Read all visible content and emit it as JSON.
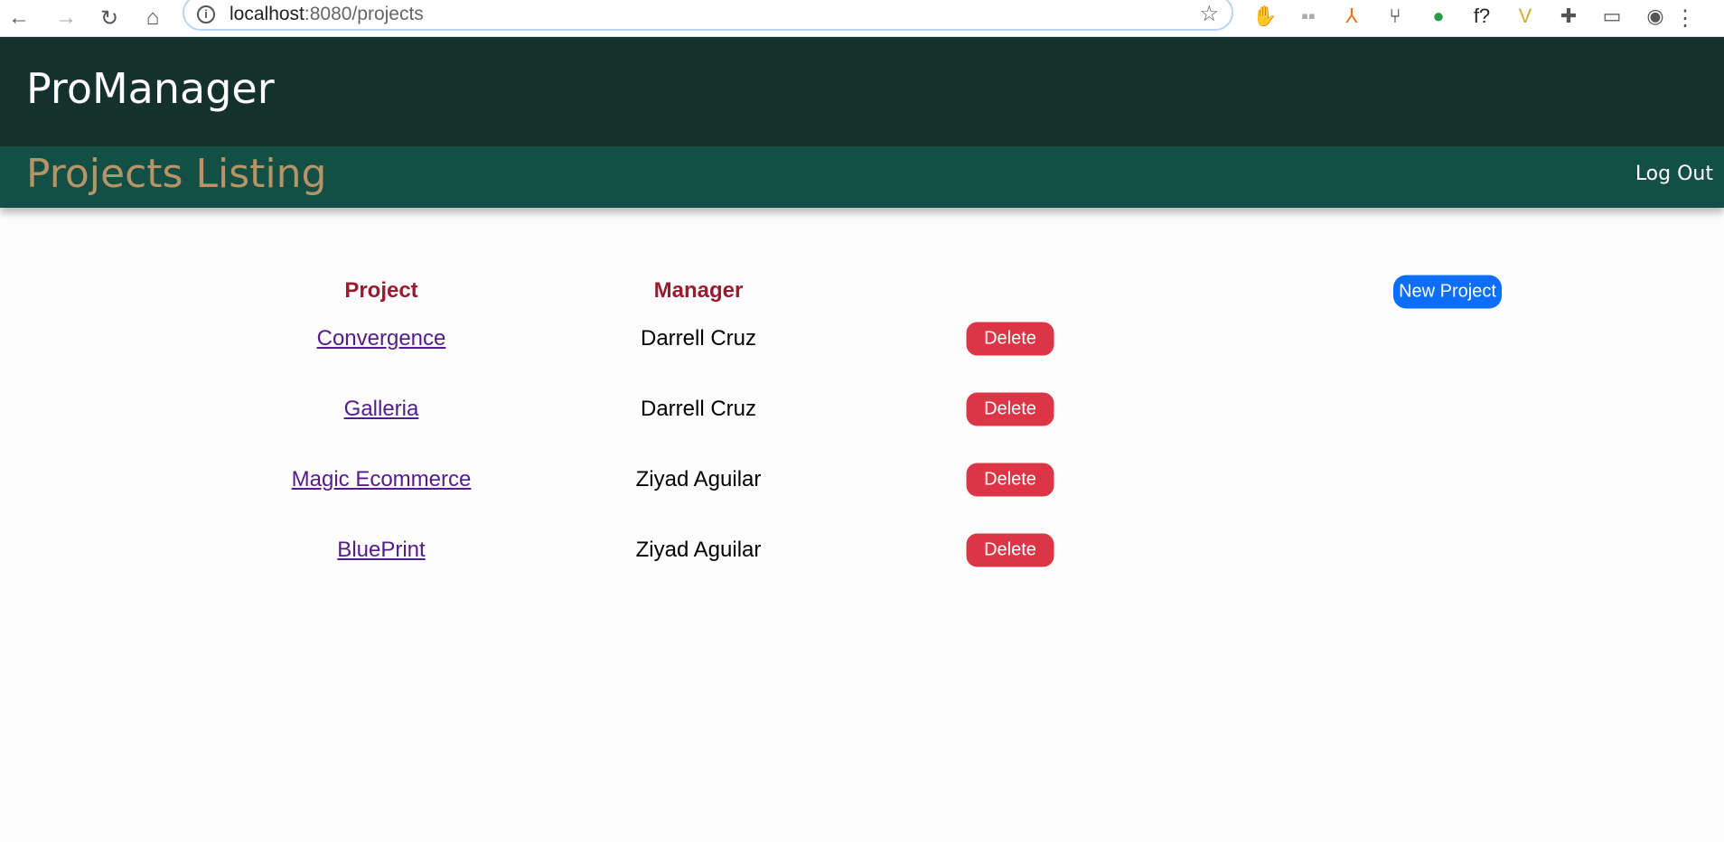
{
  "browser": {
    "url_host": "localhost",
    "url_path": ":8080/projects",
    "back": "←",
    "forward": "→",
    "reload": "↻",
    "home": "⌂",
    "star": "☆",
    "menu": "⋮",
    "extensions": [
      {
        "icon": "adblock-icon",
        "glyph": "✋",
        "color": "#e0141e"
      },
      {
        "icon": "extension-icon",
        "glyph": "▪▪",
        "color": "#aaa"
      },
      {
        "icon": "fox-icon",
        "glyph": "⅄",
        "color": "#e8731a"
      },
      {
        "icon": "git-icon",
        "glyph": "⑂",
        "color": "#222"
      },
      {
        "icon": "color-wheel-icon",
        "glyph": "●",
        "color": "#2a9d4a"
      },
      {
        "icon": "font-icon",
        "glyph": "f?",
        "color": "#222"
      },
      {
        "icon": "vue-icon",
        "glyph": "V",
        "color": "#c9b12a"
      },
      {
        "icon": "puzzle-icon",
        "glyph": "✚",
        "color": "#555"
      },
      {
        "icon": "cast-icon",
        "glyph": "▭",
        "color": "#555"
      },
      {
        "icon": "profile-icon",
        "glyph": "◉",
        "color": "#555"
      }
    ]
  },
  "app": {
    "brand": "ProManager",
    "page_title": "Projects Listing",
    "logout": "Log Out"
  },
  "table": {
    "headers": {
      "project": "Project",
      "manager": "Manager"
    },
    "new_project": "New Project",
    "rows": [
      {
        "project": "Convergence",
        "manager": "Darrell Cruz",
        "action": "Delete"
      },
      {
        "project": "Galleria",
        "manager": "Darrell Cruz",
        "action": "Delete"
      },
      {
        "project": "Magic Ecommerce",
        "manager": "Ziyad Aguilar",
        "action": "Delete"
      },
      {
        "project": "BluePrint",
        "manager": "Ziyad Aguilar",
        "action": "Delete"
      }
    ]
  },
  "colors": {
    "header": "#15312c",
    "subheader": "#144f45",
    "title": "#b59466",
    "th": "#9b1b2e",
    "delete": "#dc3545",
    "primary": "#0d6efd"
  }
}
